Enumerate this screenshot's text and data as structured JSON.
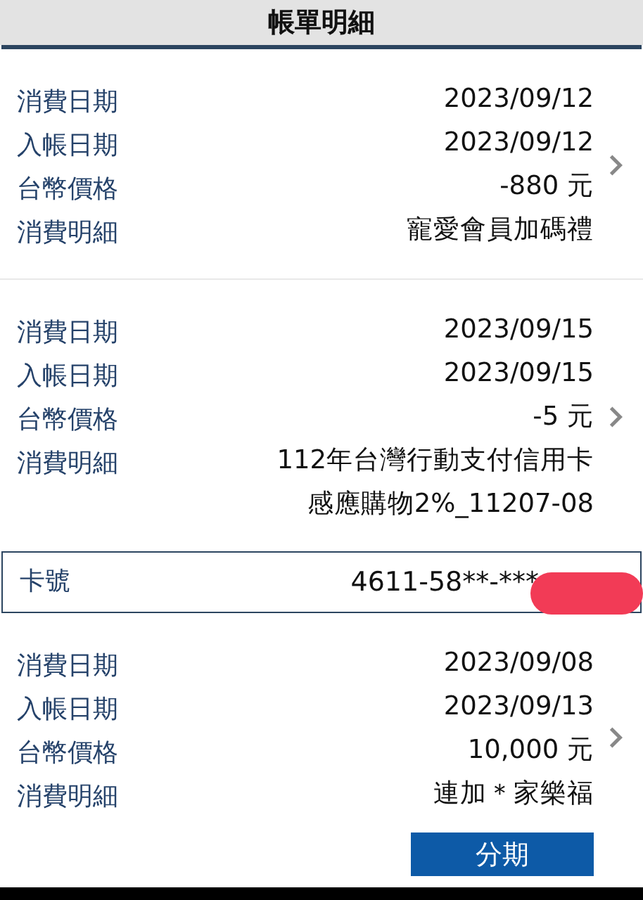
{
  "header": {
    "title": "帳單明細"
  },
  "transactions": [
    {
      "labels": [
        "消費日期",
        "入帳日期",
        "台幣價格",
        "消費明細"
      ],
      "values": [
        "2023/09/12",
        "2023/09/12",
        "-880 元",
        "寵愛會員加碼禮"
      ]
    },
    {
      "labels": [
        "消費日期",
        "入帳日期",
        "台幣價格",
        "消費明細"
      ],
      "values": [
        "2023/09/15",
        "2023/09/15",
        "-5 元",
        "112年台灣行動支付信用卡",
        "感應購物2%_11207-08"
      ]
    }
  ],
  "card": {
    "label": "卡號",
    "number": "4611-58**-***"
  },
  "card_transactions": [
    {
      "labels": [
        "消費日期",
        "入帳日期",
        "台幣價格",
        "消費明細"
      ],
      "values": [
        "2023/09/08",
        "2023/09/13",
        "10,000 元",
        "連加＊家樂福"
      ],
      "button": "分期"
    }
  ]
}
